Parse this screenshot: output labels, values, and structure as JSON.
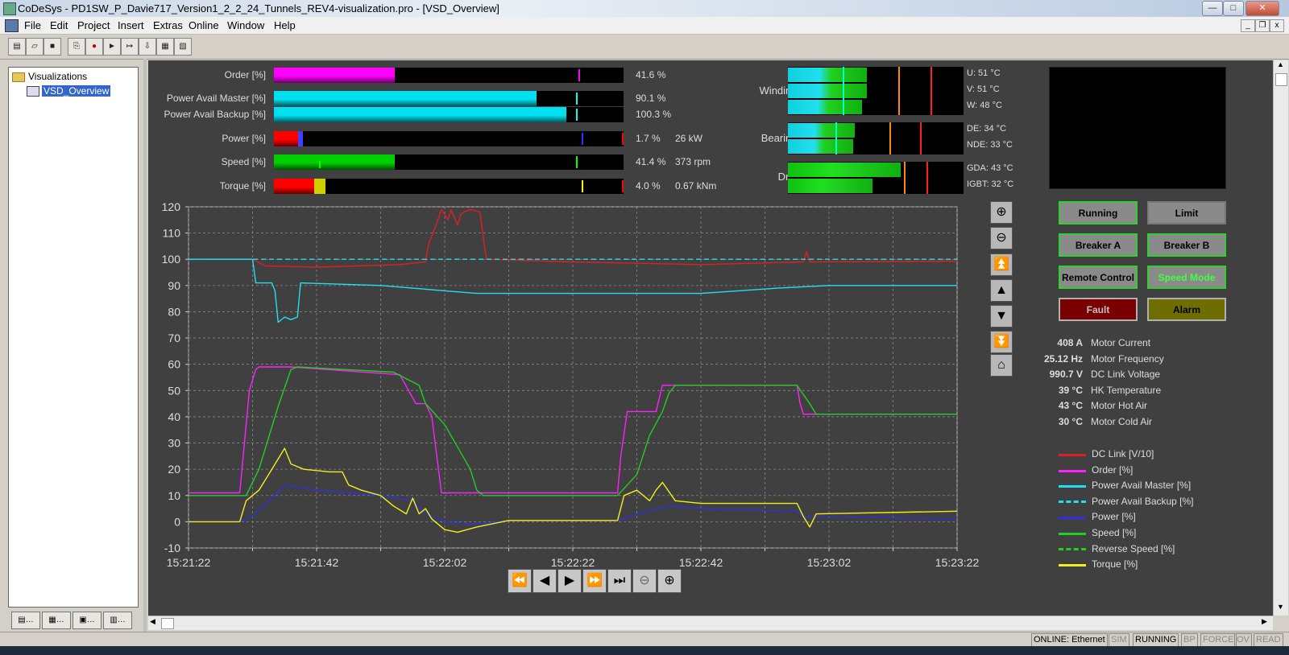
{
  "window": {
    "title": "CoDeSys - PD1SW_P_Davie717_Version1_2_2_24_Tunnels_REV4-visualization.pro - [VSD_Overview]"
  },
  "window_controls": {
    "minimize": "—",
    "maximize": "□",
    "close": "✕"
  },
  "mdi_controls": {
    "minimize": "_",
    "restore": "❐",
    "close": "x"
  },
  "menu": {
    "file": "File",
    "edit": "Edit",
    "project": "Project",
    "insert": "Insert",
    "extras": "Extras",
    "online": "Online",
    "window": "Window",
    "help": "Help"
  },
  "toolbar_icons": [
    "new-icon",
    "open-icon",
    "save-icon",
    "login-icon",
    "stop-icon",
    "run-icon",
    "step-icon",
    "download-icon",
    "print-icon",
    "print-preview-icon"
  ],
  "tree": {
    "root": "Visualizations",
    "child": "VSD_Overview"
  },
  "bars": [
    {
      "key": "order",
      "label": "Order [%]",
      "value": 41.6,
      "display": "41.6 %",
      "extra": "",
      "color": "#ff00ff",
      "marker": 0.87,
      "marker_color": "#ff00ff"
    },
    {
      "key": "pam",
      "label": "Power Avail Master [%]",
      "value": 90.1,
      "display": "90.1 %",
      "extra": "",
      "color": "#00e0f0",
      "marker": 0.865,
      "marker_color": "#00ffff"
    },
    {
      "key": "pab",
      "label": "Power Avail Backup [%]",
      "value": 100.3,
      "display": "100.3 %",
      "extra": "",
      "color": "#00e0f0",
      "marker": 0.865,
      "marker_color": "#00ffff"
    },
    {
      "key": "power",
      "label": "Power [%]",
      "value": 1.7,
      "display": "1.7 %",
      "extra": "26 kW",
      "color": "#ff0000",
      "marker": 0.88,
      "marker_color": "#3030ff"
    },
    {
      "key": "speed",
      "label": "Speed [%]",
      "value": 41.4,
      "display": "41.4 %",
      "extra": "373 rpm",
      "color": "#00d000",
      "marker": 0.865,
      "marker_color": "#00ff00"
    },
    {
      "key": "torque",
      "label": "Torque [%]",
      "value": 4.0,
      "display": "4.0 %",
      "extra": "0.67 kNm",
      "color": "#ff0000",
      "marker": 0.88,
      "marker_color": "#ffff00"
    }
  ],
  "temps": {
    "windings": {
      "label": "Windings",
      "u": "U: 51 °C",
      "v": "V: 51 °C",
      "w": "W: 48 °C"
    },
    "bearings": {
      "label": "Bearings",
      "de": "DE: 34 °C",
      "nde": "NDE: 33 °C"
    },
    "drive": {
      "label": "Drive",
      "gda": "GDA: 43 °C",
      "igbt": "IGBT: 32 °C"
    }
  },
  "temp_bars": {
    "windings": [
      0.45,
      0.45,
      0.42
    ],
    "bearings": [
      0.38,
      0.37
    ],
    "drive": [
      0.64,
      0.48
    ]
  },
  "status_buttons": {
    "running": "Running",
    "limit": "Limit",
    "breaker_a": "Breaker A",
    "breaker_b": "Breaker B",
    "remote_control": "Remote Control",
    "speed_mode": "Speed Mode",
    "fault": "Fault",
    "alarm": "Alarm"
  },
  "measurements": [
    {
      "value": "408 A",
      "label": "Motor Current"
    },
    {
      "value": "25.12 Hz",
      "label": "Motor Frequency"
    },
    {
      "value": "990.7 V",
      "label": "DC Link Voltage"
    },
    {
      "value": "39 °C",
      "label": "HK Temperature"
    },
    {
      "value": "43 °C",
      "label": "Motor Hot Air"
    },
    {
      "value": "30 °C",
      "label": "Motor Cold Air"
    }
  ],
  "legend": [
    {
      "name": "DC Link [V/10]",
      "color": "#e02020",
      "dashed": false
    },
    {
      "name": "Order [%]",
      "color": "#ff20ff",
      "dashed": false
    },
    {
      "name": "Power Avail Master [%]",
      "color": "#20e0f0",
      "dashed": false
    },
    {
      "name": "Power Avail Backup [%]",
      "color": "#20e0f0",
      "dashed": true
    },
    {
      "name": "Power [%]",
      "color": "#3030e0",
      "dashed": false
    },
    {
      "name": "Speed [%]",
      "color": "#20d020",
      "dashed": false
    },
    {
      "name": "Reverse Speed [%]",
      "color": "#20d020",
      "dashed": true
    },
    {
      "name": "Torque [%]",
      "color": "#f0f020",
      "dashed": false
    }
  ],
  "chart_data": {
    "type": "line",
    "title": "",
    "xlabel": "",
    "ylabel": "",
    "ylim": [
      -10,
      120
    ],
    "yticks": [
      120,
      110,
      100,
      90,
      80,
      70,
      60,
      50,
      40,
      30,
      20,
      10,
      0,
      -10
    ],
    "xticks": [
      "15:21:22",
      "15:21:42",
      "15:22:02",
      "15:22:22",
      "15:22:42",
      "15:23:02",
      "15:23:22"
    ],
    "xlim": [
      0,
      120
    ],
    "grid": true,
    "series": [
      {
        "name": "DC Link [V/10]",
        "color": "#e02020",
        "dashed": false,
        "points": [
          [
            0,
            100
          ],
          [
            10,
            100
          ],
          [
            12,
            97.5
          ],
          [
            20,
            97
          ],
          [
            33,
            98
          ],
          [
            37,
            99
          ],
          [
            37.5,
            106
          ],
          [
            38.5,
            112
          ],
          [
            39.5,
            119
          ],
          [
            40.5,
            115
          ],
          [
            41,
            119
          ],
          [
            42,
            113
          ],
          [
            42.5,
            117
          ],
          [
            43,
            118
          ],
          [
            44,
            119
          ],
          [
            45.5,
            118
          ],
          [
            46.5,
            100
          ],
          [
            60,
            99
          ],
          [
            80,
            98
          ],
          [
            96,
            99
          ],
          [
            96.5,
            103
          ],
          [
            97,
            99
          ],
          [
            120,
            99.3
          ]
        ]
      },
      {
        "name": "Order [%]",
        "color": "#ff20ff",
        "dashed": false,
        "points": [
          [
            0,
            11
          ],
          [
            8,
            11
          ],
          [
            9.5,
            50
          ],
          [
            10.5,
            58
          ],
          [
            11,
            59
          ],
          [
            16,
            59
          ],
          [
            33,
            56
          ],
          [
            35.5,
            45
          ],
          [
            37,
            45
          ],
          [
            38,
            40
          ],
          [
            38.5,
            30
          ],
          [
            39.5,
            11
          ],
          [
            50,
            11
          ],
          [
            67,
            11
          ],
          [
            67.5,
            25
          ],
          [
            68.5,
            42
          ],
          [
            73,
            42
          ],
          [
            74,
            52
          ],
          [
            95,
            52
          ],
          [
            95.5,
            45
          ],
          [
            96,
            41
          ],
          [
            120,
            41
          ]
        ]
      },
      {
        "name": "Power Avail Master [%]",
        "color": "#20e0f0",
        "dashed": false,
        "points": [
          [
            0,
            100
          ],
          [
            10,
            100
          ],
          [
            10.5,
            91
          ],
          [
            13,
            91
          ],
          [
            13.5,
            88
          ],
          [
            14,
            76
          ],
          [
            15,
            78
          ],
          [
            16,
            77
          ],
          [
            17,
            78
          ],
          [
            17.5,
            91
          ],
          [
            30,
            90
          ],
          [
            35,
            89
          ],
          [
            40,
            88
          ],
          [
            45,
            87
          ],
          [
            60,
            87
          ],
          [
            80,
            87
          ],
          [
            92,
            89
          ],
          [
            100,
            90
          ],
          [
            120,
            90
          ]
        ]
      },
      {
        "name": "Power Avail Backup [%]",
        "color": "#20e0f0",
        "dashed": true,
        "points": [
          [
            0,
            100
          ],
          [
            120,
            100
          ]
        ]
      },
      {
        "name": "Power [%]",
        "color": "#3030e0",
        "dashed": false,
        "points": [
          [
            0,
            0
          ],
          [
            8,
            0
          ],
          [
            10,
            2
          ],
          [
            13,
            9
          ],
          [
            15,
            14
          ],
          [
            20,
            12
          ],
          [
            25,
            11
          ],
          [
            30,
            10
          ],
          [
            35,
            8
          ],
          [
            37,
            3
          ],
          [
            40,
            0
          ],
          [
            45,
            -1
          ],
          [
            50,
            0.5
          ],
          [
            67,
            0.5
          ],
          [
            70,
            3
          ],
          [
            75,
            6
          ],
          [
            80,
            5
          ],
          [
            95,
            4
          ],
          [
            96,
            2
          ],
          [
            100,
            2
          ],
          [
            120,
            1
          ]
        ]
      },
      {
        "name": "Speed [%]",
        "color": "#20d020",
        "dashed": false,
        "points": [
          [
            0,
            10
          ],
          [
            9,
            10
          ],
          [
            11,
            20
          ],
          [
            14,
            44
          ],
          [
            16,
            58
          ],
          [
            17,
            59
          ],
          [
            32,
            57
          ],
          [
            36,
            52
          ],
          [
            37,
            45
          ],
          [
            40,
            37
          ],
          [
            44,
            20
          ],
          [
            45,
            12
          ],
          [
            46,
            10
          ],
          [
            67,
            10
          ],
          [
            70,
            18
          ],
          [
            72,
            33
          ],
          [
            74,
            42
          ],
          [
            75,
            49
          ],
          [
            76,
            52
          ],
          [
            95,
            52
          ],
          [
            97,
            45
          ],
          [
            98,
            41
          ],
          [
            120,
            41
          ]
        ]
      },
      {
        "name": "Torque [%]",
        "color": "#f0f020",
        "dashed": false,
        "points": [
          [
            0,
            0
          ],
          [
            8,
            0
          ],
          [
            9,
            8
          ],
          [
            11,
            12
          ],
          [
            13,
            20
          ],
          [
            15,
            28
          ],
          [
            16,
            22
          ],
          [
            18,
            20
          ],
          [
            22,
            19
          ],
          [
            24,
            19
          ],
          [
            25,
            14
          ],
          [
            27,
            12
          ],
          [
            30,
            10
          ],
          [
            32,
            6
          ],
          [
            34,
            3
          ],
          [
            35,
            9
          ],
          [
            36,
            3
          ],
          [
            37,
            5
          ],
          [
            38,
            1
          ],
          [
            40,
            -3
          ],
          [
            42,
            -4
          ],
          [
            45,
            -2
          ],
          [
            50,
            0.5
          ],
          [
            67,
            0.5
          ],
          [
            68,
            10
          ],
          [
            70,
            12
          ],
          [
            72,
            8
          ],
          [
            73,
            12
          ],
          [
            74,
            15
          ],
          [
            76,
            8
          ],
          [
            80,
            7
          ],
          [
            95,
            7
          ],
          [
            96,
            2
          ],
          [
            97,
            -2
          ],
          [
            98,
            3
          ],
          [
            120,
            4
          ]
        ]
      }
    ]
  },
  "chart_nav": {
    "zoom_in": "zoom-in-icon",
    "zoom_out": "zoom-out-icon",
    "page_up": "⏫",
    "up": "▲",
    "down": "▼",
    "page_down": "⏬",
    "home": "home-icon"
  },
  "playback": [
    "⏪",
    "◀",
    "▶",
    "⏩",
    "⏭",
    "zoom-out-icon",
    "zoom-in-icon"
  ],
  "statusbar": {
    "online": "ONLINE: Ethernet",
    "sim": "SIM",
    "running": "RUNNING",
    "bp": "BP",
    "force": "FORCE",
    "ov": "OV",
    "read": "READ"
  }
}
